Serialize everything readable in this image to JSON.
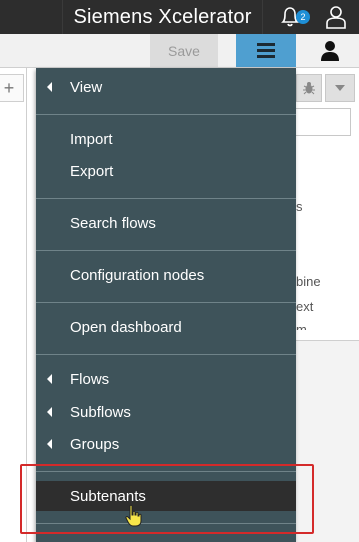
{
  "header": {
    "title": "Siemens Xcelerator",
    "notification_count": "2",
    "icons": [
      "bell-icon",
      "user-icon"
    ]
  },
  "toolbar": {
    "save_label": "Save",
    "menu_icon": "hamburger-icon",
    "user_icon": "user-icon"
  },
  "workspace": {
    "add_tab_label": "+",
    "background_fragments": [
      "s",
      "bine",
      "ext",
      "m"
    ]
  },
  "menu": {
    "items": [
      {
        "label": "View",
        "submenu": true
      },
      {
        "label": "Import",
        "submenu": false
      },
      {
        "label": "Export",
        "submenu": false
      },
      {
        "label": "Search flows",
        "submenu": false
      },
      {
        "label": "Configuration nodes",
        "submenu": false
      },
      {
        "label": "Open dashboard",
        "submenu": false
      },
      {
        "label": "Flows",
        "submenu": true
      },
      {
        "label": "Subflows",
        "submenu": true
      },
      {
        "label": "Groups",
        "submenu": true
      },
      {
        "label": "Subtenants",
        "submenu": false,
        "hovered": true
      }
    ]
  },
  "colors": {
    "menu_bg": "#3e535a",
    "menu_hover": "#2e2e2e",
    "accent": "#4f9fd0",
    "highlight": "#d42a2a",
    "header_bg": "#2d2d2d"
  }
}
